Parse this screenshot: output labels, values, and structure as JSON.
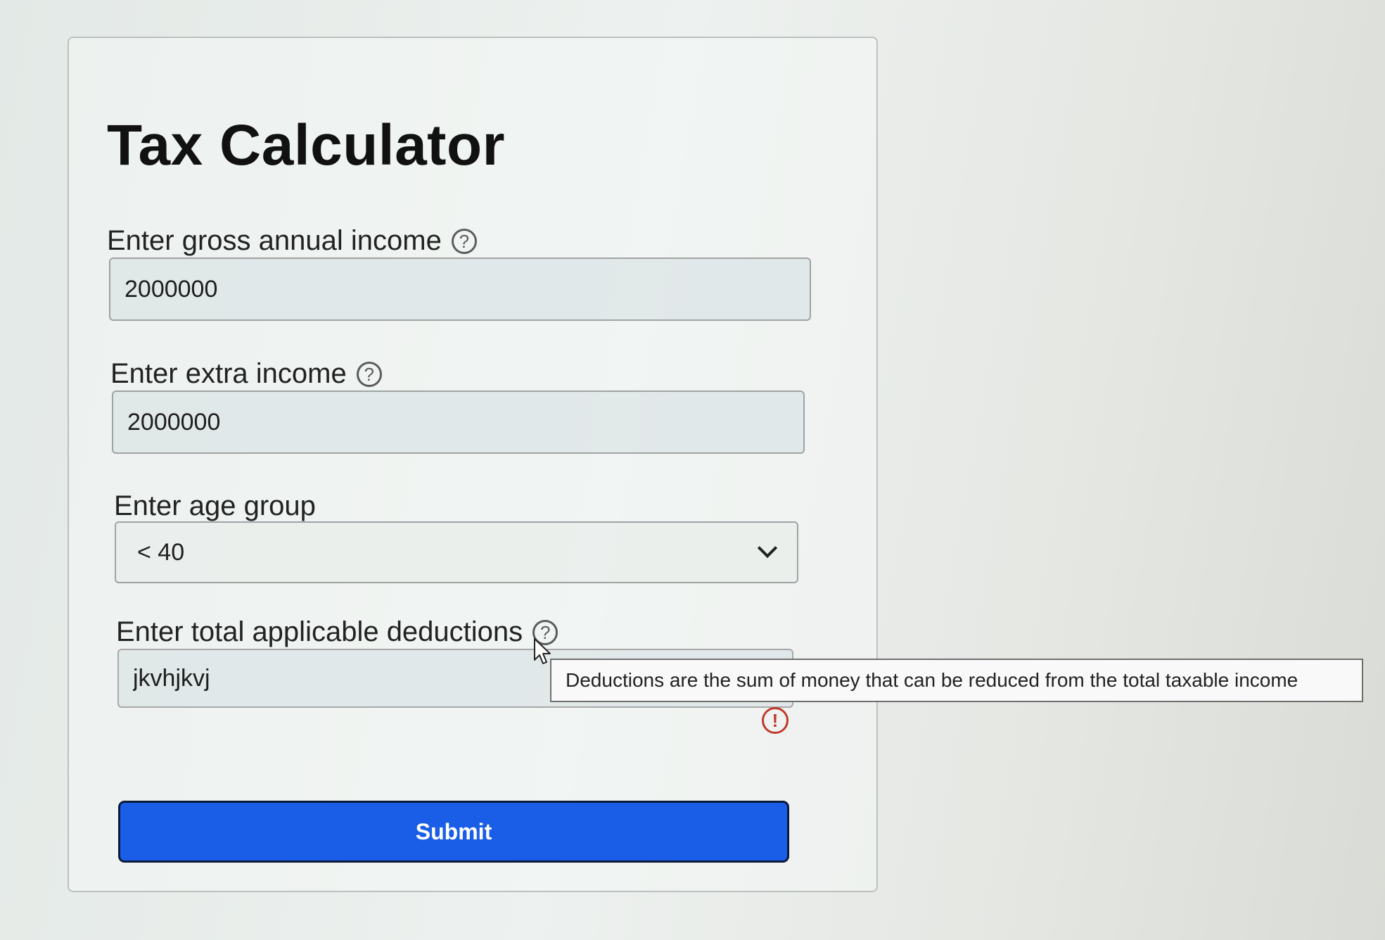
{
  "page": {
    "title": "Tax Calculator"
  },
  "form": {
    "gross_income": {
      "label": "Enter gross annual income",
      "help_icon": "question-circle-icon",
      "value": "2000000"
    },
    "extra_income": {
      "label": "Enter extra income",
      "help_icon": "question-circle-icon",
      "value": "2000000"
    },
    "age_group": {
      "label": "Enter age group",
      "selected": "< 40",
      "icon": "chevron-down-icon"
    },
    "deductions": {
      "label": "Enter total applicable deductions",
      "help_icon": "question-circle-icon",
      "value": "jkvhjkvj",
      "tooltip": "Deductions are the sum of money that can be reduced from the total taxable income",
      "error_icon": "exclamation-circle-icon",
      "error_color": "#c0392b"
    },
    "submit_label": "Submit"
  },
  "icons": {
    "help_glyph": "?",
    "error_glyph": "!"
  },
  "colors": {
    "accent": "#1a5ee8"
  }
}
